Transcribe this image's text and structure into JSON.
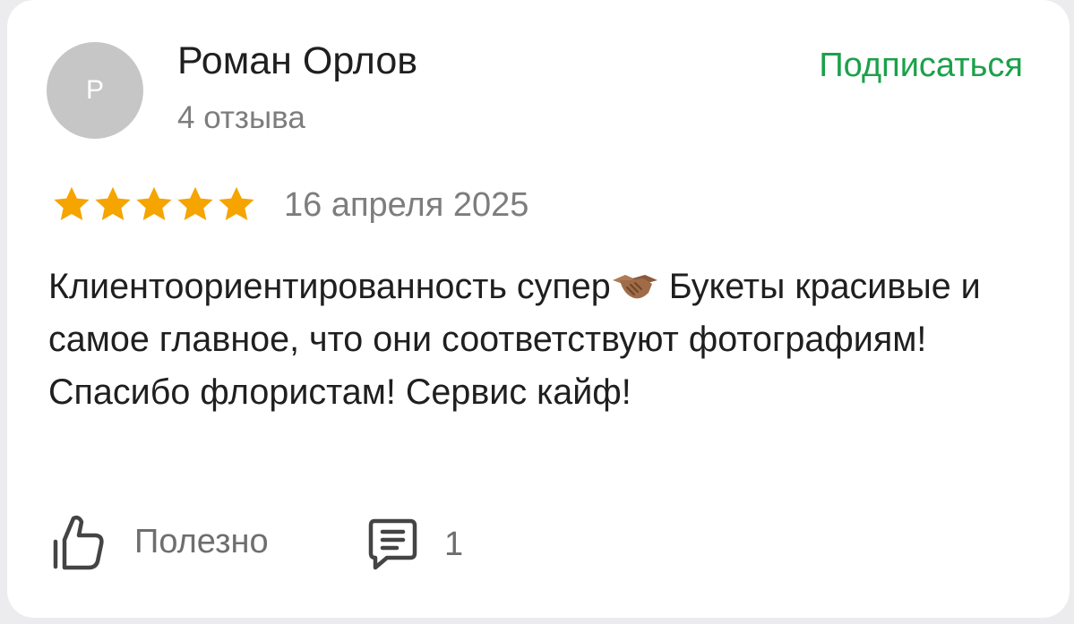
{
  "author": {
    "initial": "Р",
    "name": "Роман Орлов",
    "reviews_count": "4 отзыва",
    "avatar_color": "#c6c6c6"
  },
  "subscribe_label": "Подписаться",
  "rating": {
    "value": 5,
    "max": 5,
    "star_color": "#f5a400"
  },
  "date": "16 апреля 2025",
  "review": {
    "text_before_emoji": "Клиентоориентированность супер",
    "emoji": "handshake-emoji",
    "text_after_emoji": " Букеты красивые и самое главное, что они соответствуют фотографиям! Спасибо флористам! Сервис кайф!"
  },
  "actions": {
    "helpful_label": "Полезно",
    "comments_count": "1"
  },
  "colors": {
    "accent_green": "#1ba14a",
    "secondary_text": "#7d7d7d"
  }
}
